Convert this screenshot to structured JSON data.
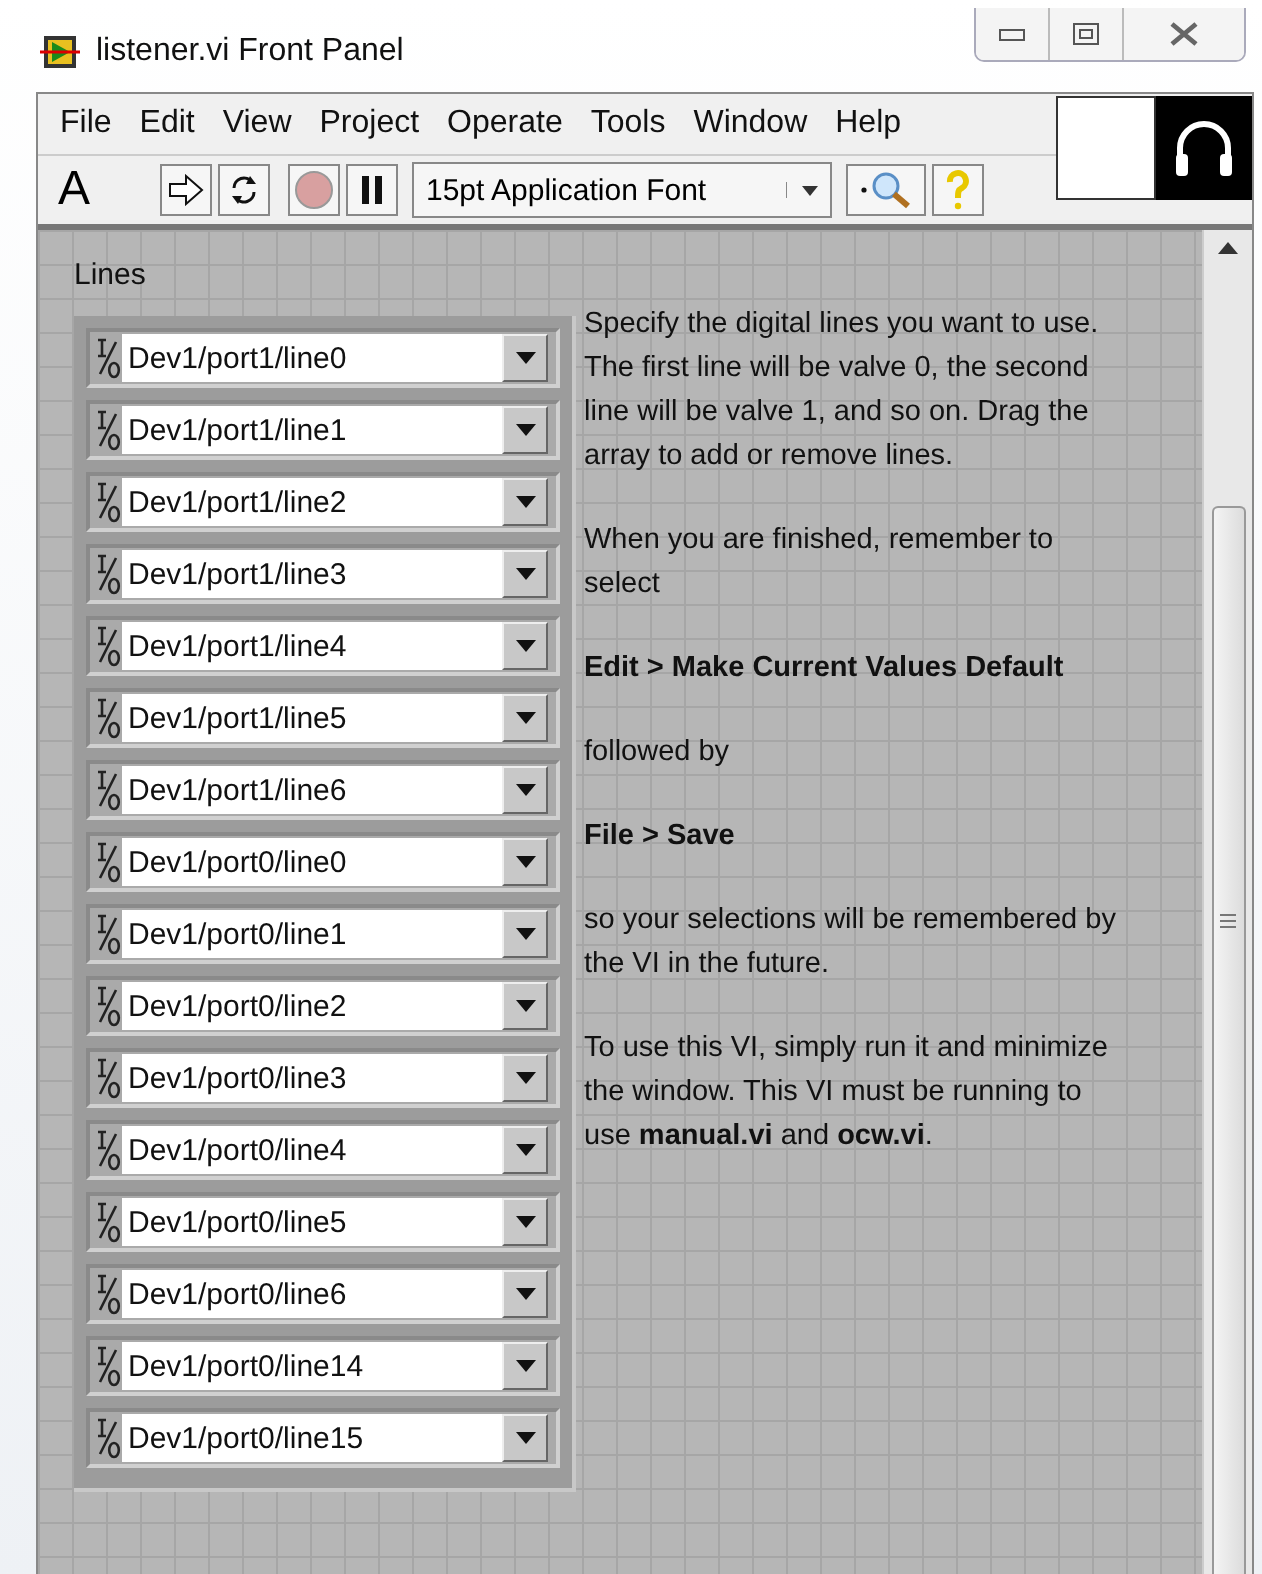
{
  "window": {
    "title": "listener.vi Front Panel"
  },
  "menu": [
    "File",
    "Edit",
    "View",
    "Project",
    "Operate",
    "Tools",
    "Window",
    "Help"
  ],
  "toolbar": {
    "text_tool": "A",
    "font": "15pt Application Font"
  },
  "lines": {
    "label": "Lines",
    "items": [
      {
        "value": "Dev1/port1/line0"
      },
      {
        "value": "Dev1/port1/line1"
      },
      {
        "value": "Dev1/port1/line2"
      },
      {
        "value": "Dev1/port1/line3"
      },
      {
        "value": "Dev1/port1/line4"
      },
      {
        "value": "Dev1/port1/line5"
      },
      {
        "value": "Dev1/port1/line6"
      },
      {
        "value": "Dev1/port0/line0"
      },
      {
        "value": "Dev1/port0/line1"
      },
      {
        "value": "Dev1/port0/line2"
      },
      {
        "value": "Dev1/port0/line3"
      },
      {
        "value": "Dev1/port0/line4"
      },
      {
        "value": "Dev1/port0/line5"
      },
      {
        "value": "Dev1/port0/line6"
      },
      {
        "value": "Dev1/port0/line14"
      },
      {
        "value": "Dev1/port0/line15"
      }
    ]
  },
  "notes": [
    {
      "kind": "plain",
      "text": "Specify the digital lines you want to use.  The first line will be valve 0, the second line will be valve 1, and so on. Drag the array to add or remove lines."
    },
    {
      "kind": "plain",
      "text": "When you are finished, remember to select"
    },
    {
      "kind": "command",
      "text": "Edit > Make Current Values Default"
    },
    {
      "kind": "plain",
      "text": "followed by"
    },
    {
      "kind": "command",
      "text": "File > Save"
    },
    {
      "kind": "plain",
      "text": "so your selections will be remembered by the VI in the future."
    },
    {
      "kind": "plain",
      "text": "To use this VI, simply run it and minimize the window.  This VI must be running to use **manual.vi** and **ocw.vi**."
    }
  ]
}
